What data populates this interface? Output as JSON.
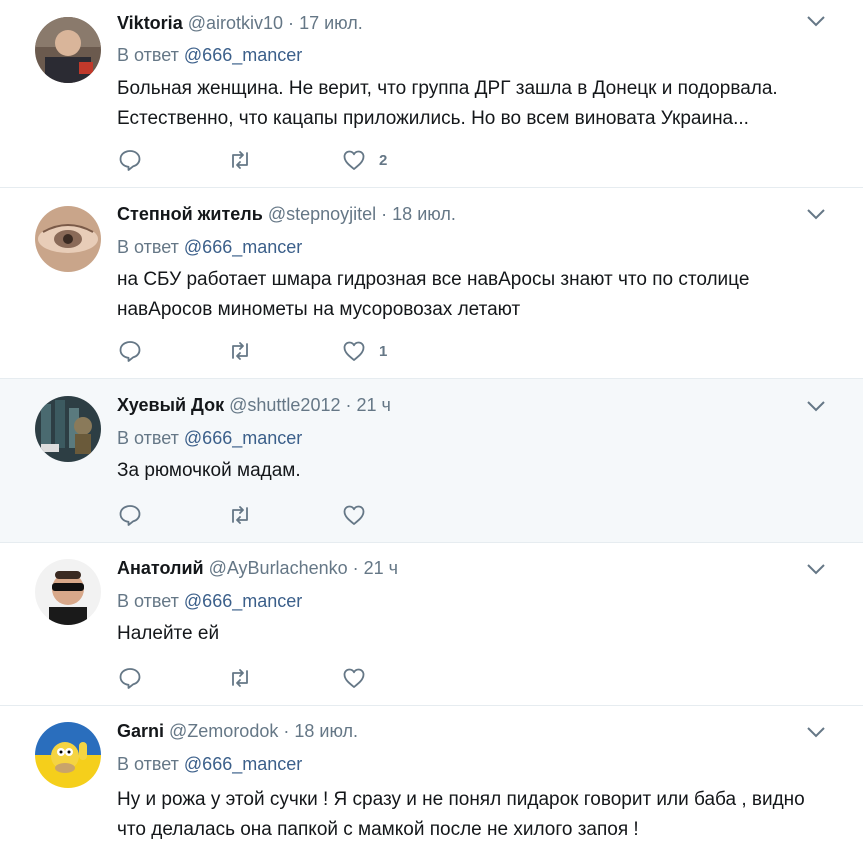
{
  "tweets": [
    {
      "name": "Viktoria",
      "handle": "@airotkiv10",
      "time": "17 июл.",
      "reply_prefix": "В ответ",
      "reply_to": "@666_mancer",
      "text_lines": [
        "Больная женщина. Не верит, что группа ДРГ зашла в Донецк и подорвала.",
        "Естественно, что кацапы приложились. Но во всем виновата Украина..."
      ],
      "like_count": "2"
    },
    {
      "name": "Степной житель",
      "handle": "@stepnoyjitel",
      "time": "18 июл.",
      "reply_prefix": "В ответ",
      "reply_to": "@666_mancer",
      "text_lines": [
        "на СБУ работает шмара гидрозная все навAросы знают что по столице",
        "навAросов минометы на мусоровозах летают"
      ],
      "like_count": "1"
    },
    {
      "name": "Хуевый Док",
      "handle": "@shuttle2012",
      "time": "21 ч",
      "reply_prefix": "В ответ",
      "reply_to": "@666_mancer",
      "text_lines": [
        "За рюмочкой мадам."
      ],
      "like_count": ""
    },
    {
      "name": "Анатолий",
      "handle": "@AyBurlachenko",
      "time": "21 ч",
      "reply_prefix": "В ответ",
      "reply_to": "@666_mancer",
      "text_lines": [
        "Налейте ей"
      ],
      "like_count": ""
    },
    {
      "name": "Garni",
      "handle": "@Zemorodok",
      "time": "18 июл.",
      "reply_prefix": "В ответ",
      "reply_to": "@666_mancer",
      "text_lines": [
        "Ну и рожа у этой сучки ! Я сразу и не понял пидарок говорит или баба , видно",
        "что делалась она папкой с мамкой после не хилого запоя !"
      ],
      "like_count": ""
    }
  ],
  "colors": {
    "muted": "#657786",
    "link": "#3b5f8a",
    "border": "#e6ecf0",
    "highlight_bg": "#f5f8fa"
  }
}
